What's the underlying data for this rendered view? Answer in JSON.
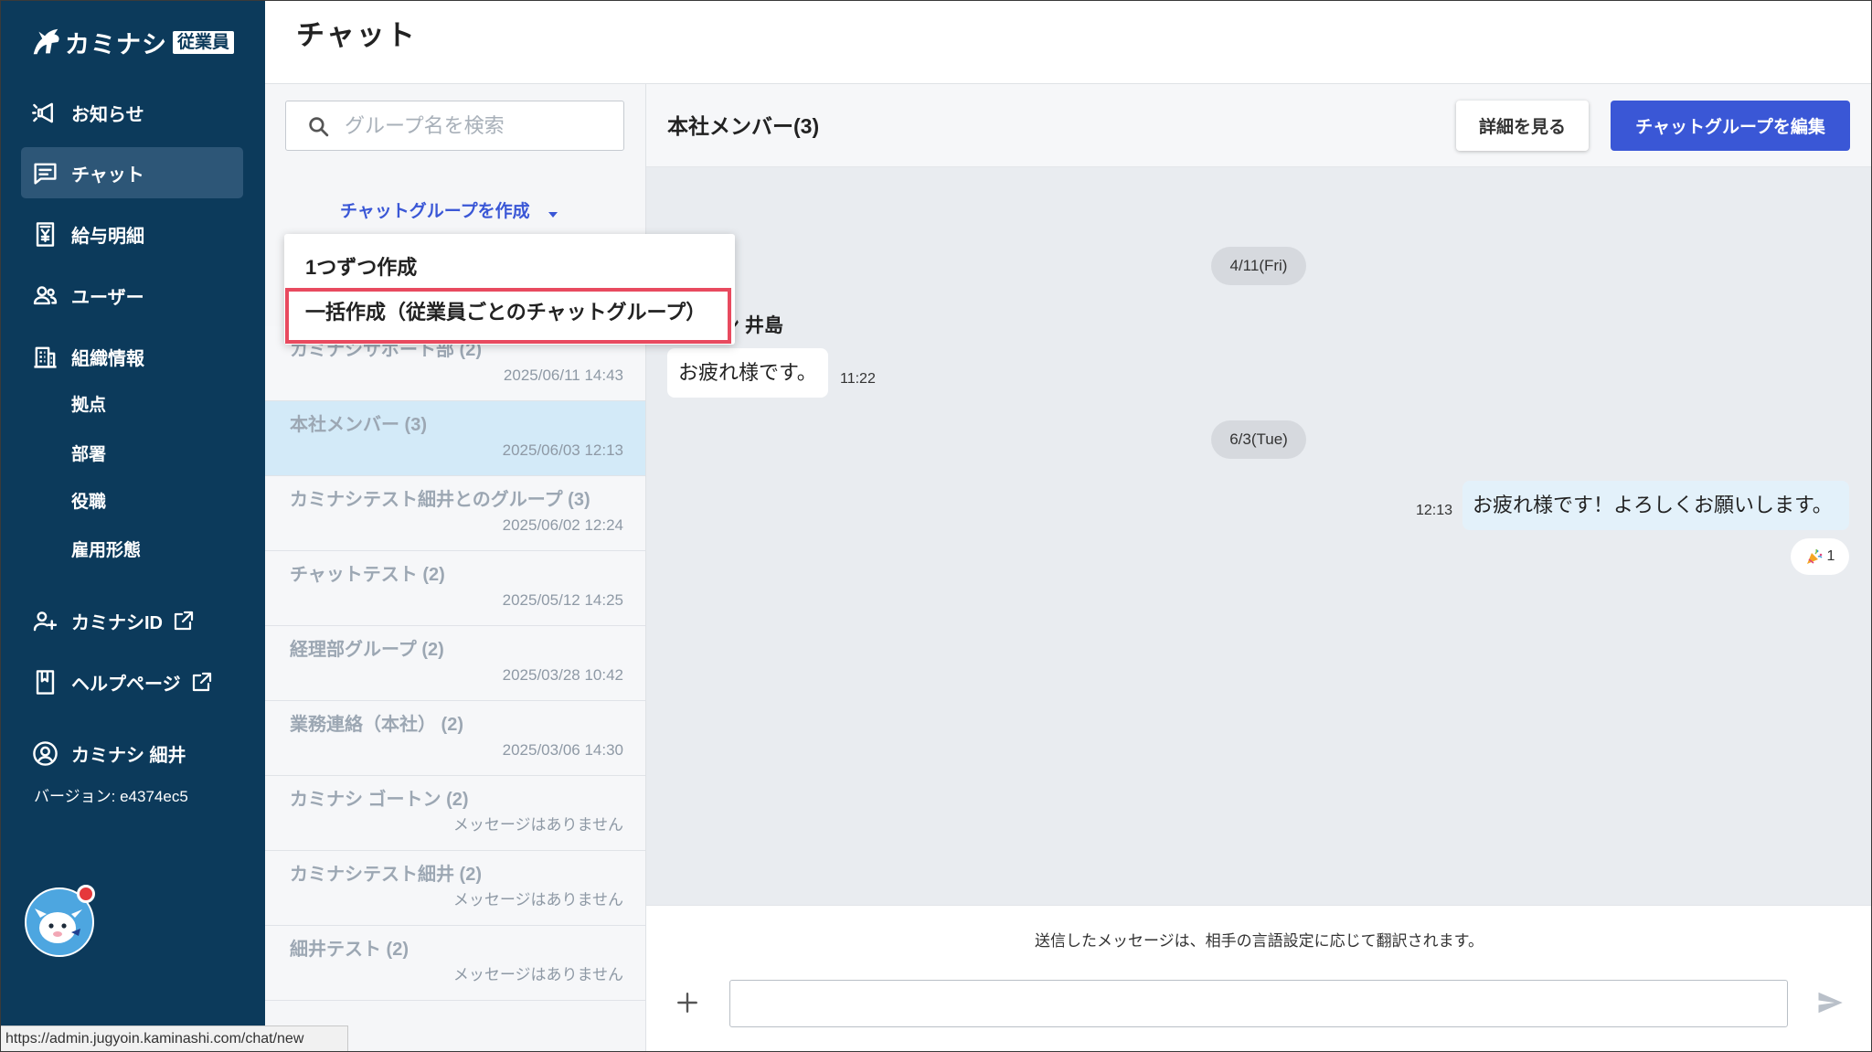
{
  "app": {
    "logo_text": "カミナシ",
    "logo_badge": "従業員",
    "logo_icon": "kaminashi-bird-icon"
  },
  "sidebar": {
    "items": [
      {
        "label": "お知らせ",
        "icon": "megaphone-icon"
      },
      {
        "label": "チャット",
        "icon": "chat-icon",
        "active": true
      },
      {
        "label": "給与明細",
        "icon": "payslip-icon"
      },
      {
        "label": "ユーザー",
        "icon": "users-icon"
      },
      {
        "label": "組織情報",
        "icon": "building-icon"
      }
    ],
    "sub_items": [
      "拠点",
      "部署",
      "役職",
      "雇用形態"
    ],
    "external_links": [
      {
        "label": "カミナシID",
        "icon": "add-user-icon"
      },
      {
        "label": "ヘルプページ",
        "icon": "book-icon"
      }
    ],
    "user": {
      "name": "カミナシ 細井",
      "icon": "user-circle-icon"
    },
    "version": "バージョン: e4374ec5"
  },
  "header": {
    "title": "チャット"
  },
  "group_list": {
    "search_placeholder": "グループ名を検索",
    "create_label": "チャットグループを作成",
    "create_menu": [
      "1つずつ作成",
      "一括作成（従業員ごとのチャットグループ）"
    ],
    "groups": [
      {
        "name": "カミナシサポート部 (2)",
        "last_activity": "2025/06/11 14:43"
      },
      {
        "name": "本社メンバー (3)",
        "last_activity": "2025/06/03 12:13",
        "selected": true
      },
      {
        "name": "カミナシテスト細井とのグループ (3)",
        "last_activity": "2025/06/02 12:24"
      },
      {
        "name": "チャットテスト (2)",
        "last_activity": "2025/05/12 14:25"
      },
      {
        "name": "経理部グループ (2)",
        "last_activity": "2025/03/28 10:42"
      },
      {
        "name": "業務連絡（本社） (2)",
        "last_activity": "2025/03/06 14:30"
      },
      {
        "name": "カミナシ ゴートン (2)",
        "last_activity": "メッセージはありません"
      },
      {
        "name": "カミナシテスト細井 (2)",
        "last_activity": "メッセージはありません"
      },
      {
        "name": "細井テスト (2)",
        "last_activity": "メッセージはありません"
      }
    ]
  },
  "chat": {
    "title": "本社メンバー(3)",
    "details_button": "詳細を見る",
    "edit_button": "チャットグループを編集",
    "date_separators": [
      "4/11(Fri)",
      "6/3(Tue)"
    ],
    "incoming": {
      "sender": "ン 井島",
      "text": "お疲れ様です。",
      "time": "11:22"
    },
    "outgoing": {
      "text": "お疲れ様です！よろしくお願いします。",
      "time": "12:13",
      "reaction": {
        "icon": "party-popper-icon",
        "count": "1"
      }
    },
    "translation_notice": "送信したメッセージは、相手の言語設定に応じて翻訳されます。"
  },
  "status_bar": {
    "url": "https://admin.jugyoin.kaminashi.com/chat/new"
  },
  "colors": {
    "sidebar_bg": "#0c3a5b",
    "accent": "#3a57d6",
    "highlight_border": "#e84a5f",
    "selected_row": "#d3eaf8"
  }
}
